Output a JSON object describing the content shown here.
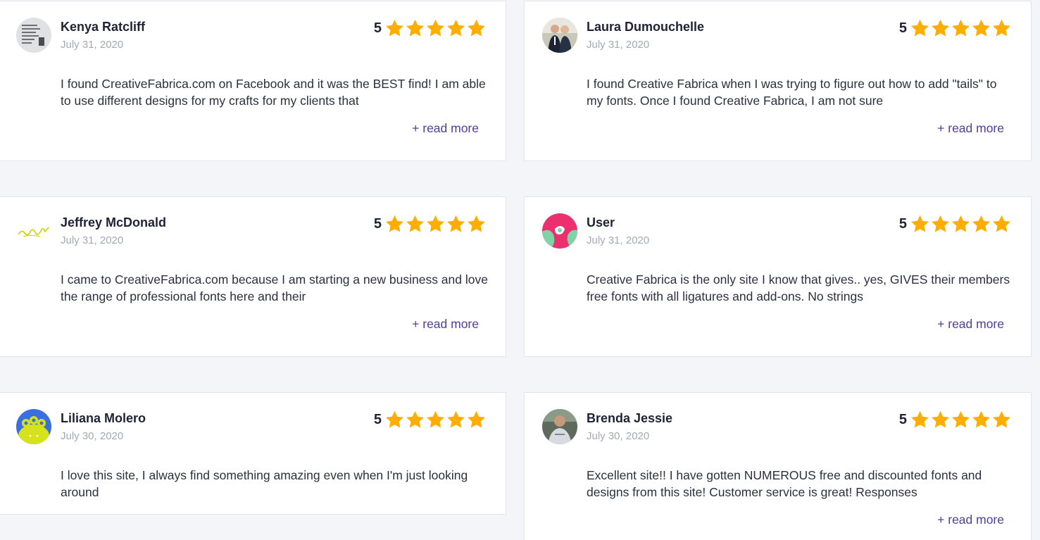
{
  "colors": {
    "background": "#f4f5f9",
    "card": "#ffffff",
    "star": "#ffae00",
    "link": "#4c3f9b",
    "date": "#a3a8b5"
  },
  "reviews": [
    {
      "name": "Kenya Ratcliff",
      "date": "July 31, 2020",
      "rating": "5",
      "text": "I found CreativeFabrica.com on Facebook and it was the BEST find! I am able to use different designs for my crafts for my clients that",
      "more": "+ read more",
      "avatar": "text-note-avatar"
    },
    {
      "name": "Laura Dumouchelle",
      "date": "July 31, 2020",
      "rating": "5",
      "text": "I found Creative Fabrica when I was trying to figure out how to add \"tails\" to my fonts. Once I found Creative Fabrica, I am not sure",
      "more": "+ read more",
      "avatar": "couple-photo-avatar"
    },
    {
      "name": "Jeffrey McDonald",
      "date": "July 31, 2020",
      "rating": "5",
      "text": "I came to CreativeFabrica.com because I am starting a new business and love the range of professional fonts here and their",
      "more": "+ read more",
      "avatar": "signature-logo-avatar"
    },
    {
      "name": "User",
      "date": "July 31, 2020",
      "rating": "5",
      "text": "Creative Fabrica is the only site I know that gives.. yes, GIVES their members free fonts with all ligatures and add-ons. No strings",
      "more": "+ read more",
      "avatar": "pink-blob-avatar"
    },
    {
      "name": "Liliana Molero",
      "date": "July 30, 2020",
      "rating": "5",
      "text": "I love this site, I always find something amazing even when I'm just looking around",
      "more": "",
      "avatar": "monster-avatar"
    },
    {
      "name": "Brenda Jessie",
      "date": "July 30, 2020",
      "rating": "5",
      "text": "Excellent site!! I have gotten NUMEROUS free and discounted fonts and designs from this site! Customer service is great! Responses",
      "more": "+ read more",
      "avatar": "person-photo-avatar"
    }
  ]
}
